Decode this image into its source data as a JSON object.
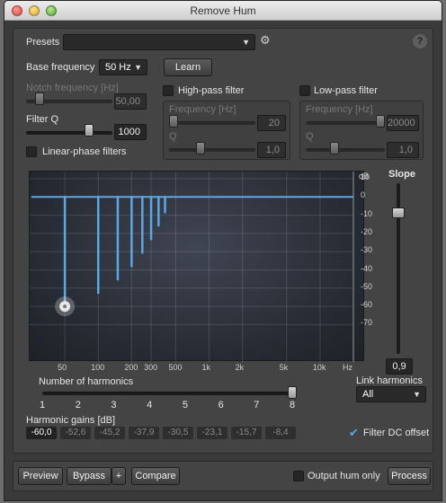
{
  "window": {
    "title": "Remove Hum"
  },
  "presets": {
    "label": "Presets",
    "value": ""
  },
  "help": {
    "label": "?"
  },
  "base_frequency": {
    "label": "Base frequency",
    "value": "50 Hz"
  },
  "learn": {
    "label": "Learn"
  },
  "notch_frequency": {
    "label": "Notch frequency [Hz]",
    "value": "50,00",
    "slider_fraction": 0.12
  },
  "filter_q": {
    "label": "Filter Q",
    "value": "1000",
    "slider_fraction": 0.75
  },
  "linear_phase": {
    "label": "Linear-phase filters",
    "checked": false
  },
  "high_pass": {
    "label": "High-pass filter",
    "checked": false,
    "frequency_label": "Frequency [Hz]",
    "frequency_value": "20",
    "frequency_fraction": 0.0,
    "q_label": "Q",
    "q_value": "1,0",
    "q_fraction": 0.35
  },
  "low_pass": {
    "label": "Low-pass filter",
    "checked": false,
    "frequency_label": "Frequency [Hz]",
    "frequency_value": "20000",
    "frequency_fraction": 1.0,
    "q_label": "Q",
    "q_value": "1,0",
    "q_fraction": 0.35
  },
  "graph": {
    "db_unit": "dB",
    "db_ticks": [
      "10",
      "0",
      "-10",
      "-20",
      "-30",
      "-40",
      "-50",
      "-60",
      "-70"
    ],
    "freq_ticks": [
      "50",
      "100",
      "200",
      "300",
      "500",
      "1k",
      "2k",
      "5k",
      "10k",
      "Hz"
    ],
    "accent": "#5aa9e6"
  },
  "slope": {
    "label": "Slope",
    "value": "0,9",
    "slider_fraction": 0.85
  },
  "harmonics": {
    "label": "Number of harmonics",
    "ticks": [
      "1",
      "2",
      "3",
      "4",
      "5",
      "6",
      "7",
      "8"
    ],
    "value": 8
  },
  "link_harmonics": {
    "label": "Link harmonics",
    "value": "All"
  },
  "harmonic_gains": {
    "label": "Harmonic gains [dB]",
    "values": [
      "-60,0",
      "-52,6",
      "-45,2",
      "-37,9",
      "-30,5",
      "-23,1",
      "-15,7",
      "-8,4"
    ]
  },
  "filter_dc": {
    "label": "Filter DC offset",
    "checked": true
  },
  "bottom": {
    "preview": "Preview",
    "bypass": "Bypass",
    "plus": "+",
    "compare": "Compare",
    "output_hum_only": "Output hum only",
    "process": "Process"
  }
}
